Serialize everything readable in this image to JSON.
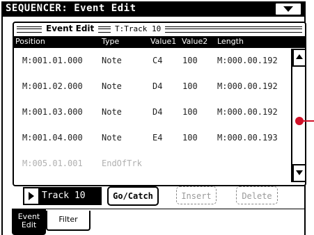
{
  "window": {
    "title": "SEQUENCER: Event Edit"
  },
  "panel": {
    "title": "Event Edit",
    "track_label": "T:Track 10"
  },
  "table": {
    "headers": [
      "Position",
      "Type",
      "Value1",
      "Value2",
      "Length"
    ],
    "rows": [
      {
        "position": "M:001.01.000",
        "type": "Note",
        "value1": "C4",
        "value2": "100",
        "length": "M:000.00.192"
      },
      {
        "position": "M:001.02.000",
        "type": "Note",
        "value1": "D4",
        "value2": "100",
        "length": "M:000.00.192"
      },
      {
        "position": "M:001.03.000",
        "type": "Note",
        "value1": "D4",
        "value2": "100",
        "length": "M:000.00.192"
      },
      {
        "position": "M:001.04.000",
        "type": "Note",
        "value1": "E4",
        "value2": "100",
        "length": "M:000.00.193"
      },
      {
        "position": "M:005.01.001",
        "type": "EndOfTrk",
        "value1": "",
        "value2": "",
        "length": ""
      }
    ]
  },
  "controls": {
    "track_select": "Track 10",
    "go_catch": "Go/Catch",
    "insert": "Insert",
    "delete": "Delete"
  },
  "tabs": [
    {
      "label_line1": "Event",
      "label_line2": "Edit",
      "active": true
    },
    {
      "label": "Filter",
      "active": false
    }
  ],
  "colors": {
    "pointer": "#d01028",
    "disabled_text": "#999999",
    "end_row_text": "#b0b0b0"
  },
  "icons": {
    "menu": "menu-arrow-down-icon",
    "scroll_up": "scroll-up-arrow-icon",
    "scroll_down": "scroll-down-arrow-icon",
    "track_play": "play-arrow-icon"
  }
}
